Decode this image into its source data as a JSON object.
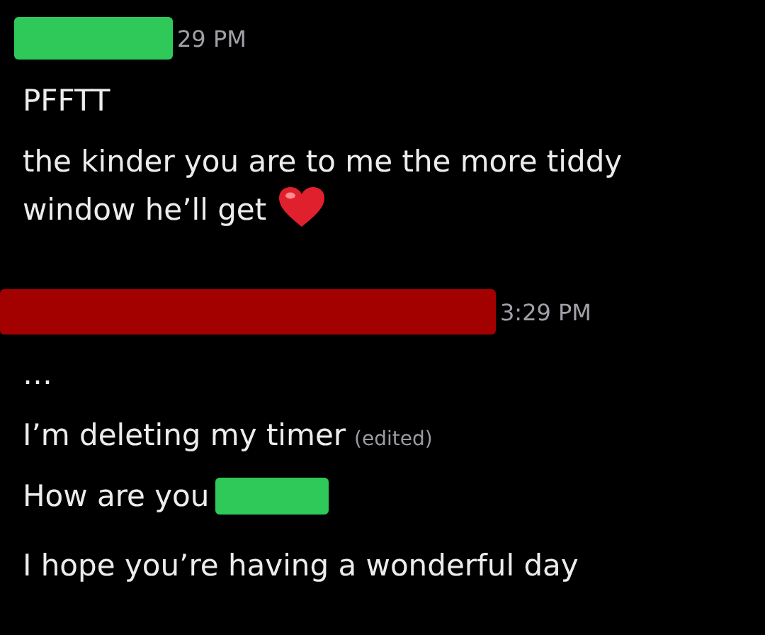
{
  "messages": [
    {
      "time": "29 PM",
      "redaction": {
        "color": "#2fc95a"
      },
      "lines": [
        {
          "text": "PFFTT"
        },
        {
          "text": "the kinder you are to me the more tiddy window he’ll get",
          "heart": true
        }
      ]
    },
    {
      "time": "3:29 PM",
      "redaction": {
        "color": "#a30000"
      },
      "lines": [
        {
          "text": "…"
        },
        {
          "text": "I’m deleting my timer",
          "edited": "(edited)"
        },
        {
          "text": "How are you",
          "redaction": {
            "color": "#2fc95a"
          }
        },
        {
          "text": "I hope you’re having a wonderful day"
        }
      ]
    }
  ]
}
